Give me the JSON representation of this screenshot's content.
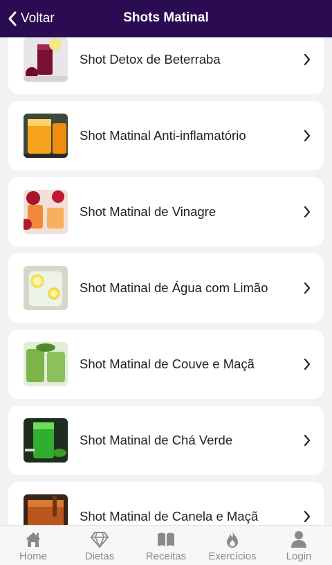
{
  "header": {
    "back_label": "Voltar",
    "title": "Shots Matinal"
  },
  "items": [
    {
      "label": "Shot Detox de Beterraba",
      "icon": "beet-juice-photo"
    },
    {
      "label": "Shot Matinal Anti-inflamatório",
      "icon": "orange-juice-photo"
    },
    {
      "label": "Shot Matinal de Vinagre",
      "icon": "vinegar-shot-photo"
    },
    {
      "label": "Shot Matinal de Água com Limão",
      "icon": "lemon-water-photo"
    },
    {
      "label": "Shot Matinal de Couve e Maçã",
      "icon": "green-juice-photo"
    },
    {
      "label": "Shot Matinal de Chá Verde",
      "icon": "green-tea-photo"
    },
    {
      "label": "Shot Matinal de Canela e Maçã",
      "icon": "cinnamon-apple-photo"
    }
  ],
  "tabs": [
    {
      "label": "Home",
      "icon": "home-icon"
    },
    {
      "label": "Dietas",
      "icon": "diamond-icon"
    },
    {
      "label": "Receitas",
      "icon": "book-icon"
    },
    {
      "label": "Exercícios",
      "icon": "flame-icon"
    },
    {
      "label": "Login",
      "icon": "user-icon"
    }
  ],
  "colors": {
    "header_bg": "#2b0c53",
    "header_text": "#ffffff",
    "background": "#f2f2f4",
    "card_bg": "#ffffff",
    "tab_icon": "#8a8a8a"
  }
}
